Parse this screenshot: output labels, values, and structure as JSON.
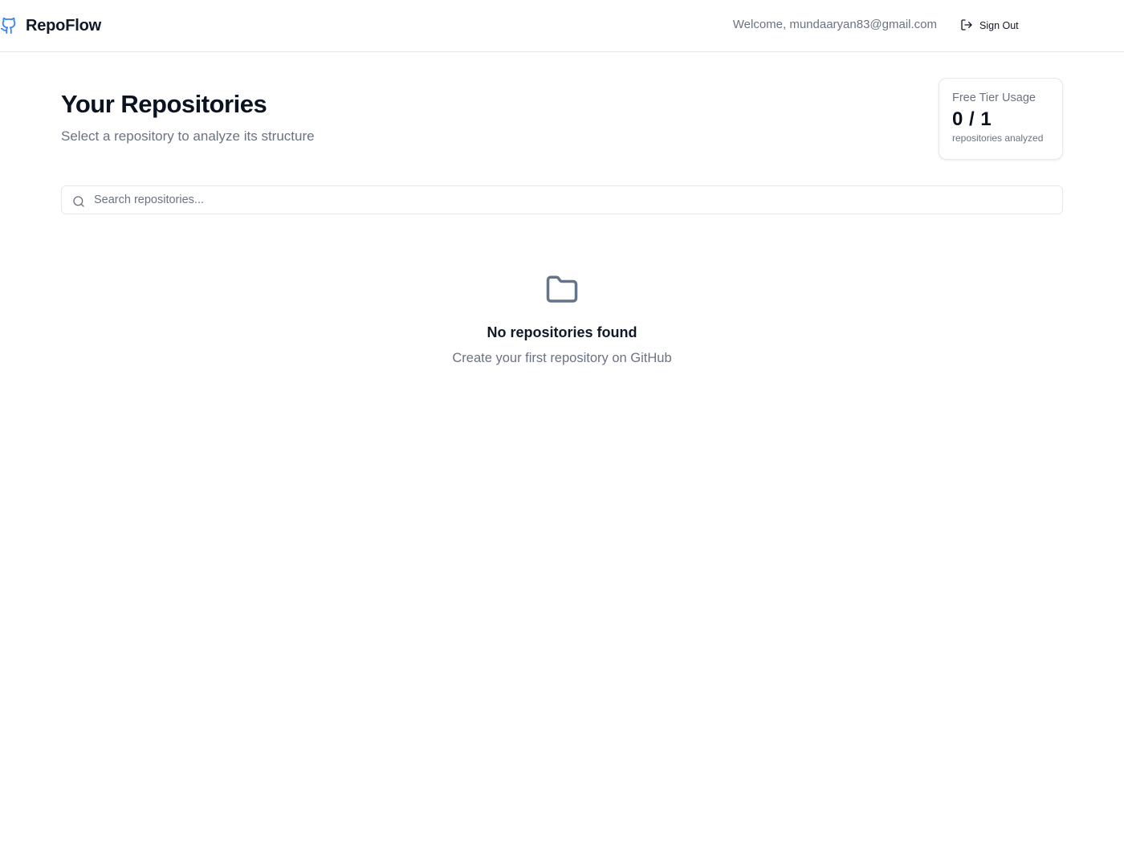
{
  "header": {
    "brand_name": "RepoFlow",
    "brand_icon": "github-icon",
    "brand_color": "#3b82f6",
    "welcome_text": "Welcome, mundaaryan83@gmail.com",
    "signout_label": "Sign Out",
    "signout_icon": "log-out-icon"
  },
  "main": {
    "title": "Your Repositories",
    "subtitle": "Select a repository to analyze its structure",
    "usage": {
      "title": "Free Tier Usage",
      "count": "0 / 1",
      "caption": "repositories analyzed"
    },
    "search": {
      "placeholder": "Search repositories...",
      "value": "",
      "icon": "search-icon"
    },
    "empty_state": {
      "icon": "folder-icon",
      "title": "No repositories found",
      "message": "Create your first repository on GitHub"
    }
  }
}
